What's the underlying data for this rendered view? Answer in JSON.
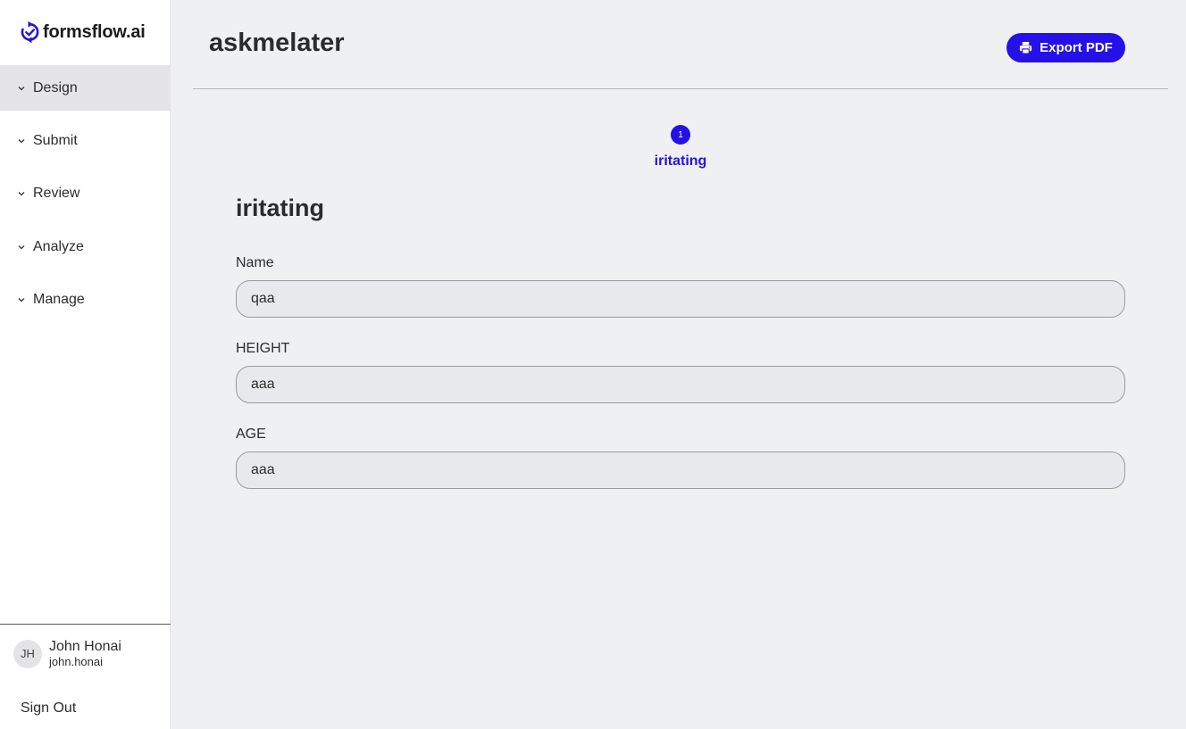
{
  "app": {
    "logo_text": "formsflow.ai",
    "accent_color": "#2511e8"
  },
  "sidebar": {
    "items": [
      {
        "label": "Design",
        "active": true
      },
      {
        "label": "Submit",
        "active": false
      },
      {
        "label": "Review",
        "active": false
      },
      {
        "label": "Analyze",
        "active": false
      },
      {
        "label": "Manage",
        "active": false
      }
    ]
  },
  "user": {
    "initials": "JH",
    "name": "John Honai",
    "handle": "john.honai",
    "signout_label": "Sign Out"
  },
  "header": {
    "title": "askmelater",
    "export_label": "Export PDF"
  },
  "wizard": {
    "step_number": "1",
    "step_label": "iritating"
  },
  "form": {
    "heading": "iritating",
    "fields": [
      {
        "label": "Name",
        "value": "qaa"
      },
      {
        "label": "HEIGHT",
        "value": "aaa"
      },
      {
        "label": "AGE",
        "value": "aaa"
      }
    ]
  }
}
